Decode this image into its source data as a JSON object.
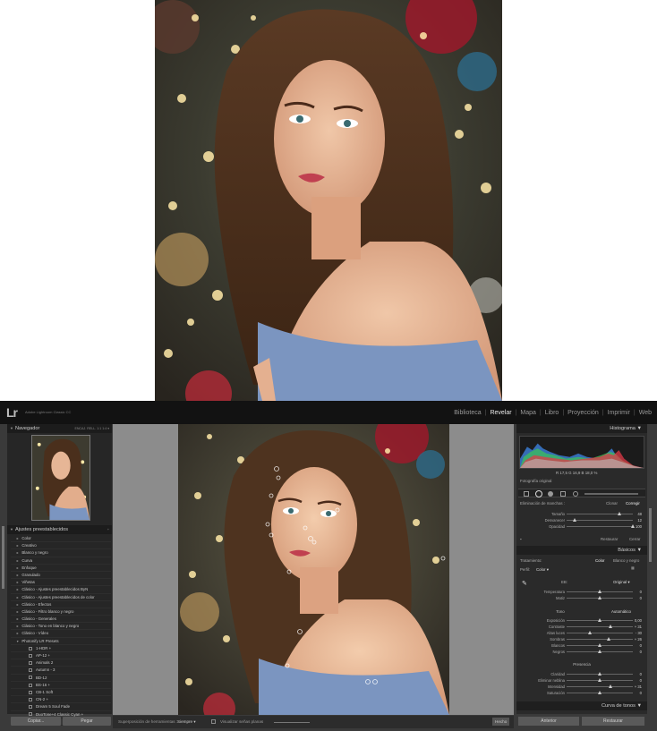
{
  "app": {
    "logo": "Lr",
    "name": "Adobe Lightroom Classic CC"
  },
  "modules": [
    "Biblioteca",
    "Revelar",
    "Mapa",
    "Libro",
    "Proyección",
    "Imprimir",
    "Web"
  ],
  "active_module": "Revelar",
  "navigator": {
    "title": "Navegador",
    "opts": "ENCAJ.  RELL.  1:1  1:4  ▾"
  },
  "presets": {
    "title": "Ajustes preestablecidos",
    "items": [
      "Color",
      "Creativo",
      "Blanco y negro",
      "Curva",
      "Enfoque",
      "Granulado",
      "Viñetas",
      "Clásico - Ajustes preestablecidos ByN",
      "Clásico - Ajustes preestablecidos de color",
      "Clásico - Efectos",
      "Clásico - Filtro blanco y negro",
      "Clásico - Generales",
      "Clásico - Tono en blanco y negro",
      "Clásico - Vídeo",
      "Photonify LR Presets"
    ],
    "sub_items": [
      "1-HDR +",
      "AP-12 +",
      "Animals 2",
      "Autumn - 3",
      "BD-12",
      "BS-16 +",
      "CB-1 Soft",
      "CN-2 +",
      "Dream 5 Soul Fade",
      "DuoTone+4 Classic Cyan +",
      "Fern 1"
    ]
  },
  "left_buttons": {
    "copy": "Copiar...",
    "paste": "Pegar"
  },
  "toolbar": {
    "overlay_label": "Superposición de herramientas :",
    "overlay_value": "Siempre ▾",
    "pins_label": "Visualizar señas planas",
    "done": "Hecho"
  },
  "right": {
    "histogram_title": "Histograma",
    "readout": "R 17,5  G 16,9  B 18,0 %",
    "original_photo": "Fotografía original",
    "spot": {
      "title": "Eliminación de manchas :",
      "clone": "Clonar",
      "heal": "Corregir",
      "sliders": [
        {
          "label": "Tamaño",
          "value": "48",
          "pos": 0.8
        },
        {
          "label": "Desvanecer",
          "value": "12",
          "pos": 0.12
        },
        {
          "label": "Opacidad",
          "value": "100",
          "pos": 1.0
        }
      ],
      "reset": "Restaurar",
      "close": "Cerrar"
    },
    "basic": {
      "title": "Básicos",
      "treatment_label": "Tratamiento:",
      "color": "Color",
      "bw": "Blanco y negro",
      "profile_label": "Perfil:",
      "profile_value": "Color ▾",
      "wb_label": "EB:",
      "wb_value": "Original ▾",
      "wb_sliders": [
        {
          "label": "Temperatura",
          "value": "0",
          "pos": 0.5
        },
        {
          "label": "Matiz",
          "value": "0",
          "pos": 0.5
        }
      ],
      "tone_label": "Tono",
      "auto": "Automático",
      "tone_sliders": [
        {
          "label": "Exposición",
          "value": "0,00",
          "pos": 0.5
        },
        {
          "label": "Contraste",
          "value": "+ 31",
          "pos": 0.66
        },
        {
          "label": "Altas luces",
          "value": "- 30",
          "pos": 0.35
        },
        {
          "label": "Sombras",
          "value": "+ 26",
          "pos": 0.63
        },
        {
          "label": "Blancos",
          "value": "0",
          "pos": 0.5
        },
        {
          "label": "Negros",
          "value": "0",
          "pos": 0.5
        }
      ],
      "presence_label": "Presencia",
      "presence_sliders": [
        {
          "label": "Claridad",
          "value": "0",
          "pos": 0.5
        },
        {
          "label": "Eliminar neblina",
          "value": "0",
          "pos": 0.5
        },
        {
          "label": "Intensidad",
          "value": "+ 31",
          "pos": 0.66
        },
        {
          "label": "Saturación",
          "value": "0",
          "pos": 0.5
        }
      ]
    },
    "tone_curve_title": "Curva de tonos"
  },
  "right_buttons": {
    "previous": "Anterior",
    "reset": "Restaurar"
  }
}
